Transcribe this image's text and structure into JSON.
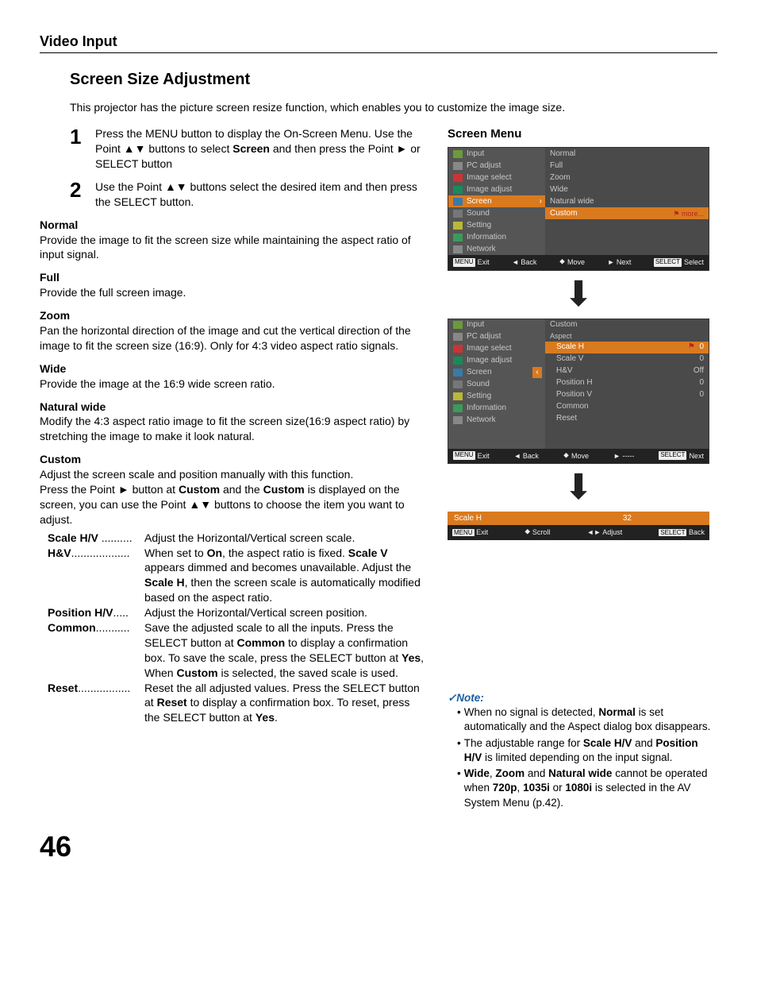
{
  "header": {
    "section": "Video Input"
  },
  "title": "Screen Size Adjustment",
  "intro": "This projector has the picture screen resize function, which enables you to customize the image size.",
  "steps": [
    {
      "num": "1",
      "pre": "Press the MENU button to display the On-Screen Menu. Use the Point ▲▼ buttons to select ",
      "bold": "Screen",
      "post": " and then press the Point ► or SELECT button"
    },
    {
      "num": "2",
      "pre": "Use the Point ▲▼ buttons select the desired item and then press the SELECT button.",
      "bold": "",
      "post": ""
    }
  ],
  "modes": {
    "normal_t": "Normal",
    "normal_d": "Provide the image to fit the screen size while maintaining the aspect ratio of input signal.",
    "full_t": "Full",
    "full_d": "Provide the full screen image.",
    "zoom_t": "Zoom",
    "zoom_d": "Pan the horizontal direction of the image and cut the vertical direction of the image to fit the screen size (16:9). Only for 4:3 video aspect ratio signals.",
    "wide_t": "Wide",
    "wide_d": "Provide the image at the 16:9 wide screen ratio.",
    "nat_t": "Natural wide",
    "nat_d": "Modify the 4:3 aspect ratio image to fit the screen size(16:9 aspect ratio) by stretching the image to make it look natural.",
    "custom_t": "Custom",
    "custom_d1": "Adjust the screen scale and position manually with this function.",
    "custom_d2a": "Press the Point ► button at ",
    "custom_d2b": "Custom",
    "custom_d2c": " and the ",
    "custom_d2d": "Custom",
    "custom_d2e": " is displayed on the screen, you can use the Point ▲▼ buttons to choose the item you want to adjust."
  },
  "defs": {
    "scale_t": "Scale H/V",
    "scale_dots": " .......... ",
    "scale_d": "Adjust the Horizontal/Vertical screen scale.",
    "hv_t": "H&V",
    "hv_dots": "................... ",
    "hv_d1": "When set to ",
    "hv_b1": "On",
    "hv_d2": ", the aspect ratio is fixed. ",
    "hv_b2": "Scale V",
    "hv_d3": " appears dimmed and becomes unavailable. Adjust the ",
    "hv_b3": "Scale H",
    "hv_d4": ", then the screen scale is automatically modified based on the aspect ratio.",
    "pos_t": "Position H/V",
    "pos_dots": ".....",
    "pos_d": "Adjust the Horizontal/Vertical screen position.",
    "com_t": "Common",
    "com_dots": "........... ",
    "com_d1": "Save the adjusted scale to all the inputs. Press the SELECT button at ",
    "com_b1": "Common",
    "com_d2": " to display a confirmation box. To save the scale, press the SELECT button at ",
    "com_b2": "Yes",
    "com_d3": ", When ",
    "com_b3": "Custom",
    "com_d4": " is selected, the saved scale is used.",
    "res_t": "Reset",
    "res_dots": "................. ",
    "res_d1": "Reset the all adjusted values. Press the SELECT button at ",
    "res_b1": "Reset",
    "res_d2": " to display a confirmation box. To reset, press the SELECT button at ",
    "res_b2": "Yes",
    "res_d3": "."
  },
  "right_title": "Screen Menu",
  "osd1": {
    "left_items": [
      "Input",
      "PC adjust",
      "Image select",
      "Image adjust",
      "Screen",
      "Sound",
      "Setting",
      "Information",
      "Network"
    ],
    "right_items": [
      "Normal",
      "Full",
      "Zoom",
      "Wide",
      "Natural wide",
      "Custom"
    ],
    "more": "more...",
    "foot": {
      "exit_badge": "MENU",
      "exit": "Exit",
      "back": "◄ Back",
      "move": "Move",
      "next": "► Next",
      "sel_badge": "SELECT",
      "sel": "Select"
    }
  },
  "osd2": {
    "left_items": [
      "Input",
      "PC adjust",
      "Image select",
      "Image adjust",
      "Screen",
      "Sound",
      "Setting",
      "Information",
      "Network"
    ],
    "right_header": "Custom",
    "right_aspect": "Aspect",
    "right_items": [
      {
        "l": "Scale H",
        "v": "0",
        "sel": true
      },
      {
        "l": "Scale V",
        "v": "0"
      },
      {
        "l": "H&V",
        "v": "Off"
      },
      {
        "l": "Position H",
        "v": "0"
      },
      {
        "l": "Position V",
        "v": "0"
      },
      {
        "l": "Common",
        "v": ""
      },
      {
        "l": "Reset",
        "v": ""
      }
    ],
    "foot": {
      "exit_badge": "MENU",
      "exit": "Exit",
      "back": "◄ Back",
      "move": "Move",
      "next": "► -----",
      "sel_badge": "SELECT",
      "sel": "Next"
    }
  },
  "osd3": {
    "label": "Scale H",
    "value": "32",
    "foot": {
      "exit_badge": "MENU",
      "exit": "Exit",
      "scroll": "Scroll",
      "adjust": "◄► Adjust",
      "back_badge": "SELECT",
      "back": "Back"
    }
  },
  "note": {
    "head": "✓Note:",
    "n1a": "When no signal is detected, ",
    "n1b": "Normal",
    "n1c": " is set automatically and the Aspect dialog box disappears.",
    "n2a": "The adjustable range for ",
    "n2b": "Scale H/V",
    "n2c": " and ",
    "n2d": "Position H/V",
    "n2e": " is limited depending on the input signal.",
    "n3b1": "Wide",
    "n3a": ", ",
    "n3b2": "Zoom",
    "n3b": " and ",
    "n3b3": "Natural wide",
    "n3c": " cannot be operated when ",
    "n3b4": "720p",
    "n3d": ", ",
    "n3b5": "1035i",
    "n3e": " or ",
    "n3b6": "1080i",
    "n3f": " is selected in the AV System Menu (p.42)."
  },
  "page_num": "46"
}
